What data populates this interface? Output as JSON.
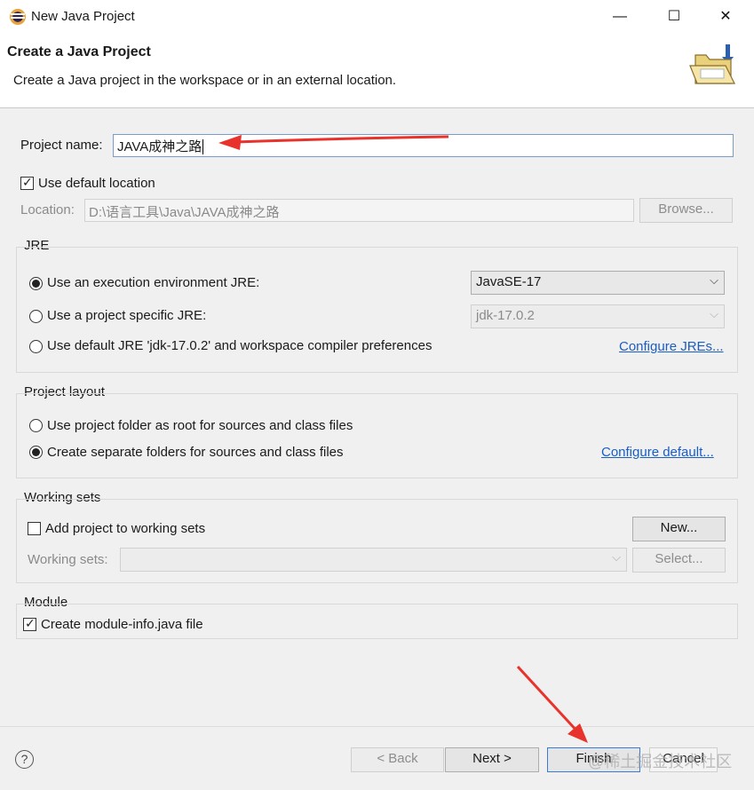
{
  "window": {
    "title": "New Java Project",
    "minimize_glyph": "—",
    "maximize_glyph": "☐",
    "close_glyph": "✕"
  },
  "header": {
    "title": "Create a Java Project",
    "description": "Create a Java project in the workspace or in an external location."
  },
  "project": {
    "name_label": "Project name:",
    "name_value": "JAVA成神之路",
    "use_default_location_label": "Use default location",
    "use_default_location_checked": true,
    "location_label": "Location:",
    "location_value": "D:\\语言工具\\Java\\JAVA成神之路",
    "browse_label": "Browse..."
  },
  "jre": {
    "title": "JRE",
    "options": [
      {
        "label": "Use an execution environment JRE:",
        "selected": true
      },
      {
        "label": "Use a project specific JRE:",
        "selected": false
      },
      {
        "label": "Use default JRE 'jdk-17.0.2' and workspace compiler preferences",
        "selected": false
      }
    ],
    "execution_env_value": "JavaSE-17",
    "project_jre_value": "jdk-17.0.2",
    "configure_link": "Configure JREs..."
  },
  "layout": {
    "title": "Project layout",
    "options": [
      {
        "label": "Use project folder as root for sources and class files",
        "selected": false
      },
      {
        "label": "Create separate folders for sources and class files",
        "selected": true
      }
    ],
    "configure_link": "Configure default..."
  },
  "working_sets": {
    "title": "Working sets",
    "add_label": "Add project to working sets",
    "add_checked": false,
    "new_label": "New...",
    "sets_label": "Working sets:",
    "sets_value": "",
    "select_label": "Select..."
  },
  "module": {
    "title": "Module",
    "create_label": "Create module-info.java file",
    "create_checked": true
  },
  "footer": {
    "help_glyph": "?",
    "back_label": "< Back",
    "next_label": "Next >",
    "finish_label": "Finish",
    "cancel_label": "Cancel"
  },
  "watermark": "@稀土掘金技术社区",
  "icons": [
    "app-icon",
    "folder-icon",
    "help-icon",
    "chevron-down-icon",
    "annotation-arrow"
  ],
  "colors": {
    "link": "#1a5ec4",
    "annotation_arrow": "#e8322b",
    "focus_border": "#7a9cc6"
  }
}
